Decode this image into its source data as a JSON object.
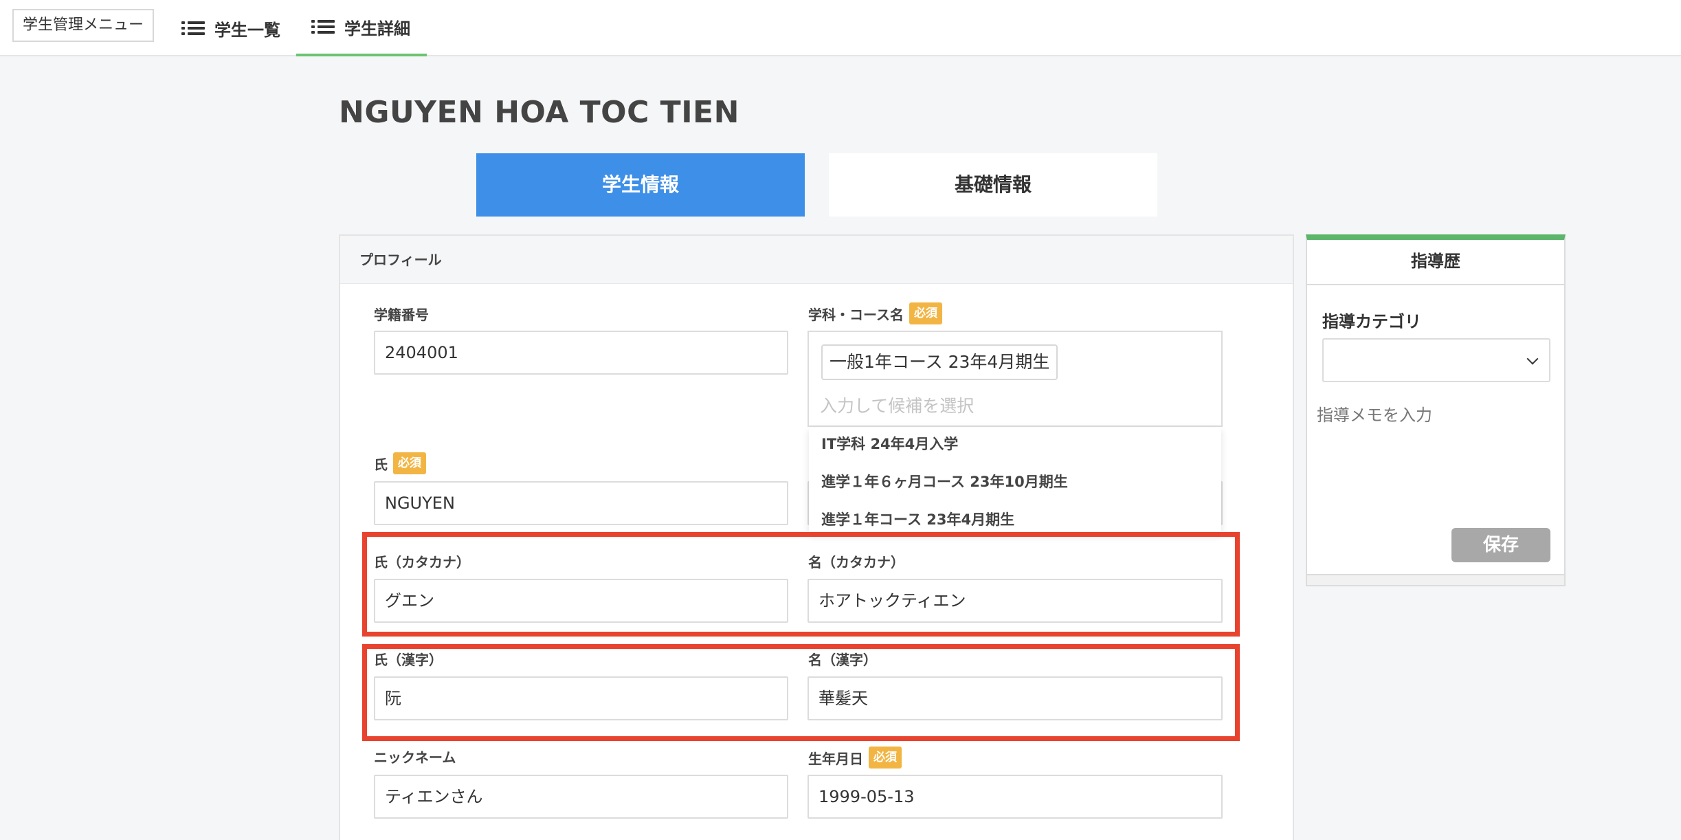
{
  "topnav": {
    "menu_label": "学生管理メニュー",
    "tabs": [
      {
        "label": "学生一覧",
        "active": false
      },
      {
        "label": "学生詳細",
        "active": true
      }
    ]
  },
  "student": {
    "name": "NGUYEN HOA TOC TIEN"
  },
  "main_tabs": [
    {
      "label": "学生情報",
      "active": true
    },
    {
      "label": "基礎情報",
      "active": false
    }
  ],
  "profile": {
    "header": "プロフィール",
    "required_badge": "必須",
    "fields": {
      "student_number": {
        "label": "学籍番号",
        "value": "2404001"
      },
      "course": {
        "label": "学科・コース名",
        "selected": "一般1年コース 23年4月期生",
        "placeholder": "入力して候補を選択",
        "options": [
          "IT学科 24年4月入学",
          "進学１年６ヶ月コース 23年10月期生",
          "進学１年コース 23年4月期生"
        ]
      },
      "last_name": {
        "label": "氏",
        "value": "NGUYEN"
      },
      "last_name_kana": {
        "label": "氏（カタカナ）",
        "value": "グエン"
      },
      "first_name_kana": {
        "label": "名（カタカナ）",
        "value": "ホアトックティエン"
      },
      "last_name_kanji": {
        "label": "氏（漢字）",
        "value": "阮"
      },
      "first_name_kanji": {
        "label": "名（漢字）",
        "value": "華髪天"
      },
      "nickname": {
        "label": "ニックネーム",
        "value": "ティエンさん"
      },
      "birthdate": {
        "label": "生年月日",
        "value": "1999-05-13"
      }
    }
  },
  "guidance": {
    "title": "指導歴",
    "category_label": "指導カテゴリ",
    "category_value": "",
    "memo_placeholder": "指導メモを入力",
    "save_label": "保存"
  },
  "colors": {
    "accent_blue": "#3d8fe8",
    "required_badge": "#f2b544",
    "highlight_red": "#e8432e",
    "guide_top": "#5cb56a",
    "save_disabled": "#a8a8a8"
  }
}
